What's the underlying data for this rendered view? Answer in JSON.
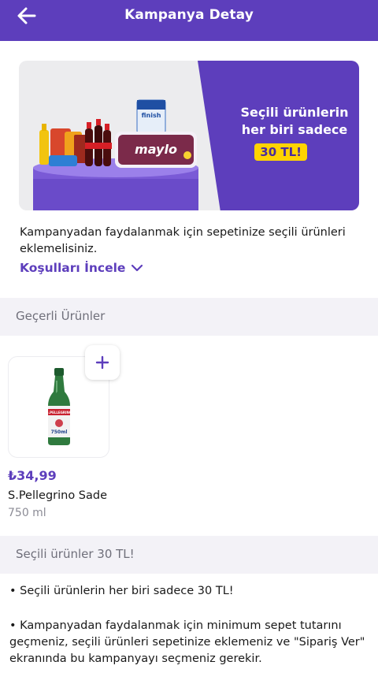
{
  "header": {
    "title": "Kampanya Detay"
  },
  "banner": {
    "headline": "Seçili ürünlerin her biri sadece",
    "price_badge": "30 TL!",
    "brand_text": "maylo",
    "finish_text": "finish"
  },
  "intro": {
    "text": "Kampanyadan faydalanmak için sepetinize seçili ürünleri eklemelisiniz.",
    "conditions_link": "Koşulları İncele"
  },
  "valid_products": {
    "section_title": "Geçerli Ürünler",
    "items": [
      {
        "price": "₺34,99",
        "name": "S.Pellegrino Sade",
        "volume": "750 ml",
        "label_text": "S.PELLEGRINO",
        "label_volume": "750ml"
      }
    ]
  },
  "campaign_info": {
    "section_title": "Seçili ürünler 30 TL!",
    "bullets": [
      "• Seçili ürünlerin her biri sadece 30 TL!",
      "• Kampanyadan faydalanmak için minimum sepet tutarını geçmeniz, seçili ürünleri sepetinize eklemeniz ve \"Sipariş Ver\" ekranında bu kampanyayı seçmeniz gerekir."
    ]
  },
  "colors": {
    "brand": "#5d3ebc",
    "accent": "#ffd300",
    "section_bg": "#f3f2f7"
  }
}
